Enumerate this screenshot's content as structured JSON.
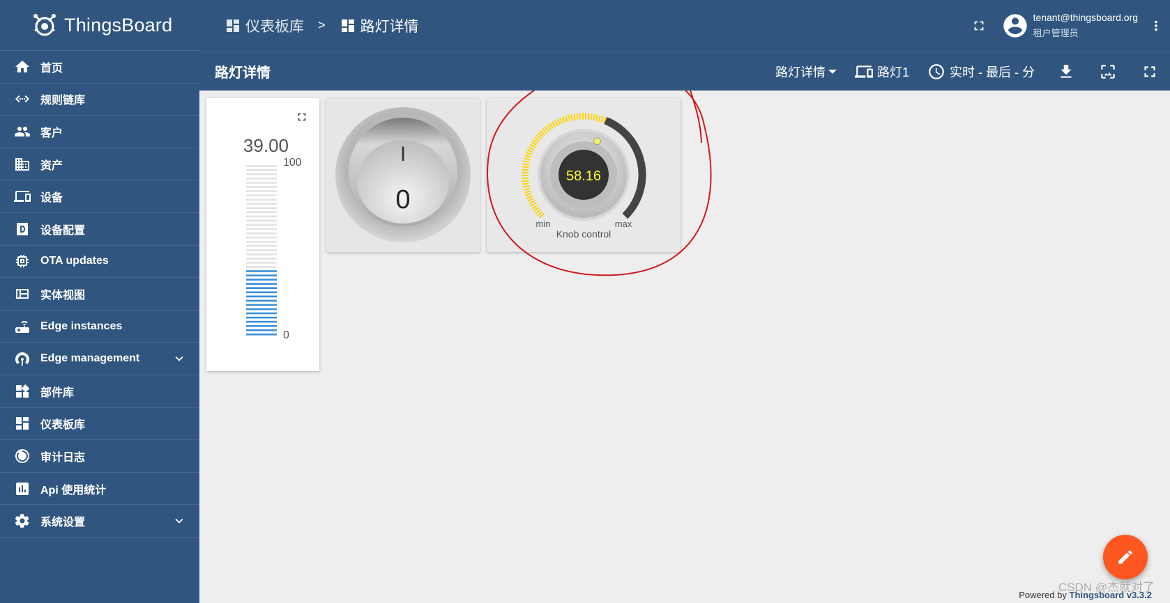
{
  "app": {
    "brand": "ThingsBoard"
  },
  "sidebar": {
    "items": [
      {
        "label": "首页",
        "icon": "home-icon"
      },
      {
        "label": "规则链库",
        "icon": "rule-chain-icon"
      },
      {
        "label": "客户",
        "icon": "customers-icon"
      },
      {
        "label": "资产",
        "icon": "assets-icon"
      },
      {
        "label": "设备",
        "icon": "devices-icon"
      },
      {
        "label": "设备配置",
        "icon": "device-profile-icon"
      },
      {
        "label": "OTA updates",
        "icon": "ota-icon"
      },
      {
        "label": "实体视图",
        "icon": "entity-view-icon"
      },
      {
        "label": "Edge instances",
        "icon": "edge-icon"
      },
      {
        "label": "Edge management",
        "icon": "edge-management-icon",
        "expandable": true
      },
      {
        "label": "部件库",
        "icon": "widgets-icon"
      },
      {
        "label": "仪表板库",
        "icon": "dashboards-icon"
      },
      {
        "label": "审计日志",
        "icon": "audit-log-icon"
      },
      {
        "label": "Api 使用统计",
        "icon": "api-usage-icon"
      },
      {
        "label": "系统设置",
        "icon": "settings-icon",
        "expandable": true
      }
    ]
  },
  "header": {
    "breadcrumb": [
      {
        "label": "仪表板库"
      },
      {
        "label": "路灯详情"
      }
    ],
    "separator": ">",
    "user": {
      "email": "tenant@thingsboard.org",
      "role": "租户管理员"
    }
  },
  "dashboard": {
    "title": "路灯详情",
    "state_selector": "路灯详情",
    "entity": "路灯1",
    "timewindow": "实时 - 最后 - 分"
  },
  "widgets": {
    "level": {
      "value": "39.00",
      "max": "100",
      "min": "0",
      "fraction": 0.39
    },
    "switch": {
      "on_label": "I",
      "off_label": "0",
      "state": "off"
    },
    "knob": {
      "value": "58.16",
      "min_label": "min",
      "max_label": "max",
      "title": "Knob control",
      "fraction": 0.5816
    }
  },
  "footer": {
    "powered_prefix": "Powered by",
    "powered_brand": "Thingsboard v3.3.2",
    "watermark": "CSDN @杰就对了"
  },
  "colors": {
    "primary": "#305680",
    "fab": "#ff5722",
    "level_bar": "#3a8fd8",
    "knob_value": "#ffff33",
    "knob_arc": "#ffd400",
    "annotation": "#d0191b"
  }
}
